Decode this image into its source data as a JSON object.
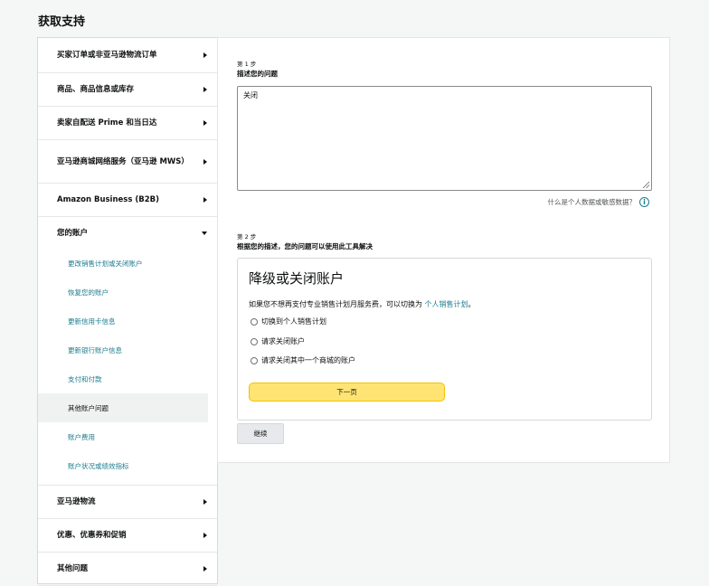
{
  "page": {
    "title": "获取支持"
  },
  "sidebar": {
    "items": [
      {
        "label": "买家订单或非亚马逊物流订单"
      },
      {
        "label": "商品、商品信息或库存"
      },
      {
        "label": "卖家自配送 Prime 和当日达"
      },
      {
        "label": "亚马逊商城网络服务（亚马逊 MWS）"
      },
      {
        "label": "Amazon Business (B2B)"
      },
      {
        "label": "您的账户",
        "expanded": true,
        "children": [
          {
            "label": "更改销售计划或关闭账户"
          },
          {
            "label": "恢复您的账户"
          },
          {
            "label": "更新信用卡信息"
          },
          {
            "label": "更新银行账户信息"
          },
          {
            "label": "支付和付款"
          },
          {
            "label": "其他账户问题",
            "active": true
          },
          {
            "label": "账户费用"
          },
          {
            "label": "账户状况或绩效指标"
          }
        ]
      },
      {
        "label": "亚马逊物流"
      },
      {
        "label": "优惠、优惠券和促销"
      },
      {
        "label": "其他问题"
      }
    ]
  },
  "step1": {
    "number": "第 1 步",
    "title": "描述您的问题",
    "description_value": "关闭",
    "sensitive_link": "什么是个人数据或敏感数据？",
    "info_icon": "i"
  },
  "step2": {
    "number": "第 2 步",
    "title": "根据您的描述，您的问题可以使用此工具解决"
  },
  "tool": {
    "title": "降级或关闭账户",
    "desc_prefix": "如果您不想再支付专业销售计划月服务费，可以切换为",
    "desc_link": "个人销售计划",
    "desc_suffix": "。",
    "options": [
      {
        "label": "切换到个人销售计划"
      },
      {
        "label": "请求关闭账户"
      },
      {
        "label": "请求关闭其中一个商城的账户"
      }
    ],
    "next_label": "下一页"
  },
  "continue_label": "继续",
  "colors": {
    "link": "#1b7b8c",
    "primary_button": "#ffe473",
    "active_bg": "#f0f2f2"
  }
}
